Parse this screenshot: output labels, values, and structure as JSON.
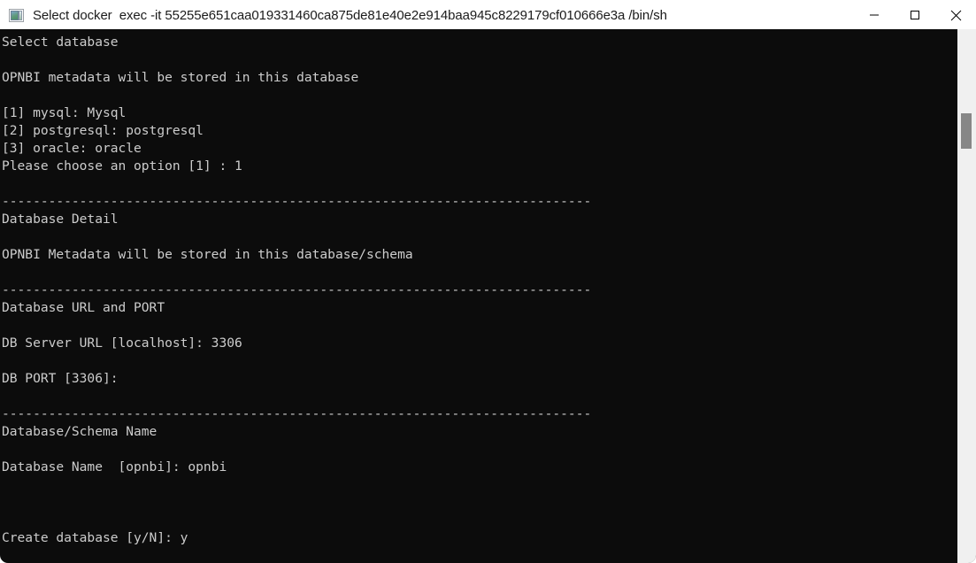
{
  "window": {
    "title": "Select docker  exec -it 55255e651caa019331460ca875de81e40e2e914baa945c8229179cf010666e3a /bin/sh",
    "icon": "console-window-icon",
    "controls": {
      "minimize_label": "Minimize",
      "maximize_label": "Maximize",
      "close_label": "Close"
    }
  },
  "colors": {
    "titlebar_background": "#ffffff",
    "titlebar_text": "#1b1b1b",
    "terminal_background": "#0c0c0c",
    "terminal_text": "#cccccc",
    "scrollbar_track": "#f0f0f0",
    "scrollbar_thumb": "#878787"
  },
  "terminal": {
    "separator": "----------------------------------------------------------------------------",
    "lines": [
      "Select database",
      "",
      "OPNBI metadata will be stored in this database",
      "",
      "[1] mysql: Mysql",
      "[2] postgresql: postgresql",
      "[3] oracle: oracle",
      "Please choose an option [1] : 1",
      "",
      "----------------------------------------------------------------------------",
      "Database Detail",
      "",
      "OPNBI Metadata will be stored in this database/schema",
      "",
      "----------------------------------------------------------------------------",
      "Database URL and PORT",
      "",
      "DB Server URL [localhost]: 3306",
      "",
      "DB PORT [3306]:",
      "",
      "----------------------------------------------------------------------------",
      "Database/Schema Name",
      "",
      "Database Name  [opnbi]: opnbi",
      "",
      "",
      "",
      "Create database [y/N]: y"
    ],
    "prompts": {
      "select_database_heading": "Select database",
      "metadata_notice": "OPNBI metadata will be stored in this database",
      "option_1": "[1] mysql: Mysql",
      "option_2": "[2] postgresql: postgresql",
      "option_3": "[3] oracle: oracle",
      "choose_option": "Please choose an option [1] : 1",
      "choose_option_answer": "1",
      "database_detail_heading": "Database Detail",
      "metadata_schema_notice": "OPNBI Metadata will be stored in this database/schema",
      "url_port_heading": "Database URL and PORT",
      "db_server_url": "DB Server URL [localhost]: 3306",
      "db_server_url_default": "localhost",
      "db_server_url_answer": "3306",
      "db_port": "DB PORT [3306]:",
      "db_port_default": "3306",
      "db_port_answer": "",
      "schema_name_heading": "Database/Schema Name",
      "database_name": "Database Name  [opnbi]: opnbi",
      "database_name_default": "opnbi",
      "database_name_answer": "opnbi",
      "create_database": "Create database [y/N]: y",
      "create_database_default": "y/N",
      "create_database_answer": "y"
    }
  },
  "scrollbar": {
    "name": "vertical-scrollbar",
    "thumb_name": "scrollbar-thumb"
  }
}
